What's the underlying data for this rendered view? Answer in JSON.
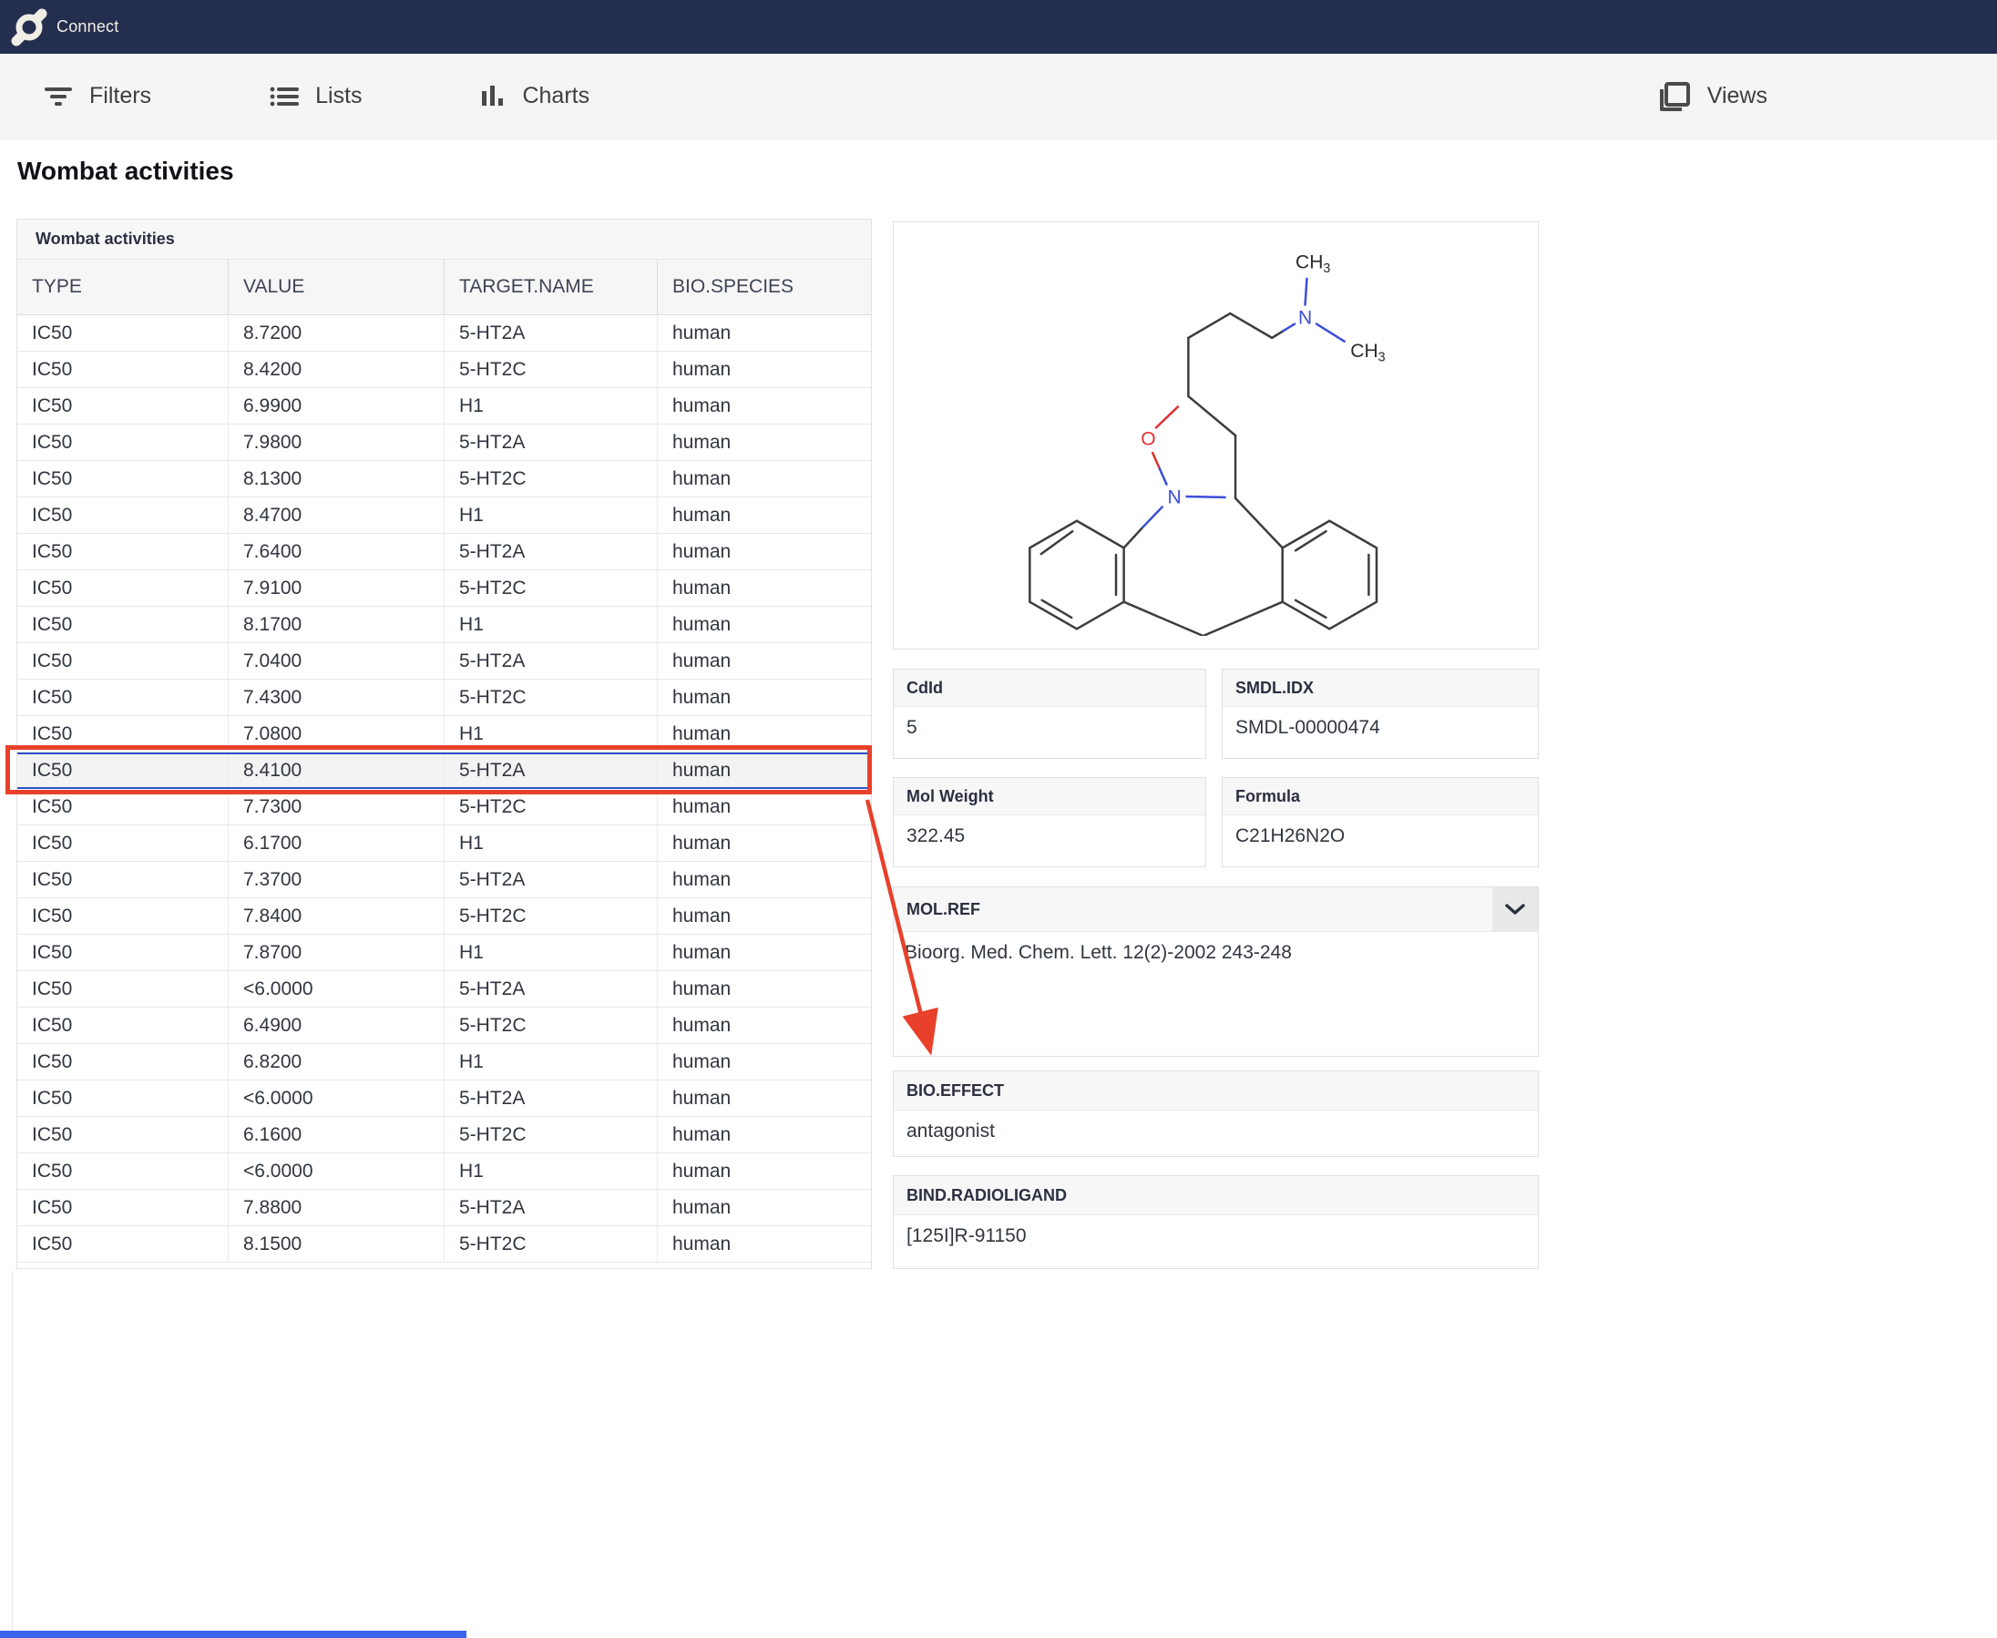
{
  "navbar": {
    "brand": "Connect"
  },
  "toolbar": {
    "filters_label": "Filters",
    "lists_label": "Lists",
    "charts_label": "Charts",
    "views_label": "Views"
  },
  "page": {
    "title": "Wombat activities"
  },
  "table": {
    "title": "Wombat activities",
    "columns": [
      "TYPE",
      "VALUE",
      "TARGET.NAME",
      "BIO.SPECIES"
    ],
    "selected_row_index": 12,
    "rows": [
      [
        "IC50",
        "8.7200",
        "5-HT2A",
        "human"
      ],
      [
        "IC50",
        "8.4200",
        "5-HT2C",
        "human"
      ],
      [
        "IC50",
        "6.9900",
        "H1",
        "human"
      ],
      [
        "IC50",
        "7.9800",
        "5-HT2A",
        "human"
      ],
      [
        "IC50",
        "8.1300",
        "5-HT2C",
        "human"
      ],
      [
        "IC50",
        "8.4700",
        "H1",
        "human"
      ],
      [
        "IC50",
        "7.6400",
        "5-HT2A",
        "human"
      ],
      [
        "IC50",
        "7.9100",
        "5-HT2C",
        "human"
      ],
      [
        "IC50",
        "8.1700",
        "H1",
        "human"
      ],
      [
        "IC50",
        "7.0400",
        "5-HT2A",
        "human"
      ],
      [
        "IC50",
        "7.4300",
        "5-HT2C",
        "human"
      ],
      [
        "IC50",
        "7.0800",
        "H1",
        "human"
      ],
      [
        "IC50",
        "8.4100",
        "5-HT2A",
        "human"
      ],
      [
        "IC50",
        "7.7300",
        "5-HT2C",
        "human"
      ],
      [
        "IC50",
        "6.1700",
        "H1",
        "human"
      ],
      [
        "IC50",
        "7.3700",
        "5-HT2A",
        "human"
      ],
      [
        "IC50",
        "7.8400",
        "5-HT2C",
        "human"
      ],
      [
        "IC50",
        "7.8700",
        "H1",
        "human"
      ],
      [
        "IC50",
        "<6.0000",
        "5-HT2A",
        "human"
      ],
      [
        "IC50",
        "6.4900",
        "5-HT2C",
        "human"
      ],
      [
        "IC50",
        "6.8200",
        "H1",
        "human"
      ],
      [
        "IC50",
        "<6.0000",
        "5-HT2A",
        "human"
      ],
      [
        "IC50",
        "6.1600",
        "5-HT2C",
        "human"
      ],
      [
        "IC50",
        "<6.0000",
        "H1",
        "human"
      ],
      [
        "IC50",
        "7.8800",
        "5-HT2A",
        "human"
      ],
      [
        "IC50",
        "8.1500",
        "5-HT2C",
        "human"
      ]
    ]
  },
  "details": {
    "cards": [
      {
        "label": "CdId",
        "value": "5"
      },
      {
        "label": "SMDL.IDX",
        "value": "SMDL-00000474"
      },
      {
        "label": "Mol Weight",
        "value": "322.45"
      },
      {
        "label": "Formula",
        "value": "C21H26N2O"
      },
      {
        "label": "MOL.REF",
        "value": "Bioorg. Med. Chem. Lett. 12(2)-2002 243-248"
      },
      {
        "label": "BIO.EFFECT",
        "value": "antagonist"
      },
      {
        "label": "BIND.RADIOLIGAND",
        "value": "[125I]R-91150"
      }
    ]
  },
  "molecule": {
    "atom_n": "N",
    "atom_o": "O",
    "methyl": "CH",
    "methyl_sub": "3"
  },
  "annotation": {
    "color": "#e8402a",
    "selection_blue": "#2d50cc"
  },
  "colors": {
    "navbar_bg": "#242e4e",
    "toolbar_bg": "#f5f5f5",
    "card_header_bg": "#f7f7f8",
    "scrollbar_thumb": "#3a63ef"
  }
}
